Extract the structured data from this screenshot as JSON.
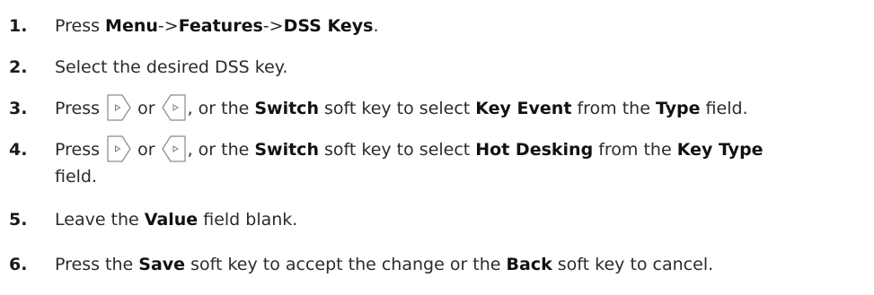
{
  "steps": [
    {
      "num": "1.",
      "parts": [
        "Press ",
        "Menu",
        "->",
        "Features",
        "->",
        "DSS Keys",
        "."
      ]
    },
    {
      "num": "2.",
      "text": "Select the desired DSS key."
    },
    {
      "num": "3.",
      "parts": [
        "Press ",
        " or ",
        ", or the ",
        "Switch",
        " soft key to select ",
        "Key Event",
        " from the ",
        "Type",
        " field."
      ]
    },
    {
      "num": "4.",
      "parts": [
        "Press ",
        " or ",
        ", or the ",
        "Switch",
        " soft key to select ",
        "Hot Desking",
        " from the ",
        "Key Type"
      ],
      "continuation": "field."
    },
    {
      "num": "5.",
      "parts": [
        "Leave the ",
        "Value",
        " field blank."
      ]
    },
    {
      "num": "6.",
      "parts": [
        "Press the ",
        "Save",
        " soft key to accept the change or the ",
        "Back",
        " soft key to cancel."
      ]
    }
  ],
  "icons": {
    "right": "right-navigation-key-icon",
    "left": "left-navigation-key-icon"
  }
}
